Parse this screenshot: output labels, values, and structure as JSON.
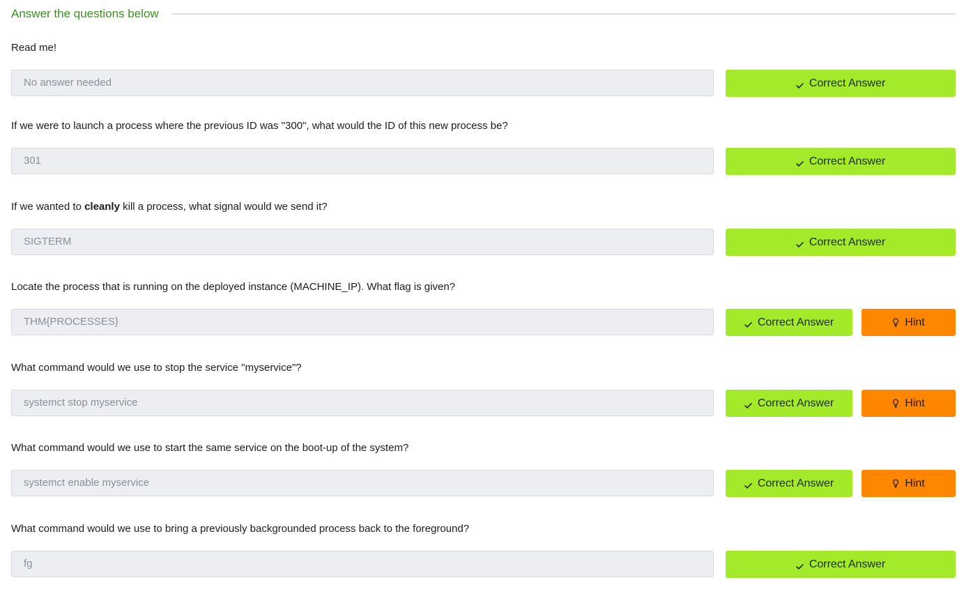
{
  "section": {
    "title": "Answer the questions below"
  },
  "labels": {
    "correct": "Correct Answer",
    "hint": "Hint"
  },
  "questions": [
    {
      "text_before": "Read me!",
      "text_bold": "",
      "text_after": "",
      "answer": "No answer needed",
      "has_hint": false
    },
    {
      "text_before": "If we were to launch a process where the previous ID was \"300\", what would the ID of this new process be?",
      "text_bold": "",
      "text_after": "",
      "answer": "301",
      "has_hint": false
    },
    {
      "text_before": "If we wanted to ",
      "text_bold": "cleanly",
      "text_after": " kill a process, what signal would we send it?",
      "answer": "SIGTERM",
      "has_hint": false
    },
    {
      "text_before": "Locate the process that is running on the deployed instance (MACHINE_IP). What flag is given?",
      "text_bold": "",
      "text_after": "",
      "answer": "THM{PROCESSES}",
      "has_hint": true
    },
    {
      "text_before": "What command would we use to stop the service \"myservice\"?",
      "text_bold": "",
      "text_after": "",
      "answer": "systemct stop myservice",
      "has_hint": true
    },
    {
      "text_before": "What command would we use to start the same service on the boot-up of the system?",
      "text_bold": "",
      "text_after": "",
      "answer": "systemct enable myservice",
      "has_hint": true
    },
    {
      "text_before": "What command would we use to bring a previously backgrounded process back to the foreground?",
      "text_bold": "",
      "text_after": "",
      "answer": "fg",
      "has_hint": false
    }
  ],
  "icons": {
    "correct": "check-icon",
    "hint": "lightbulb-icon"
  },
  "colors": {
    "title": "#3f8e25",
    "correct_button": "#a3ea2a",
    "hint_button": "#ff8700",
    "answer_bg": "#eceef2"
  }
}
